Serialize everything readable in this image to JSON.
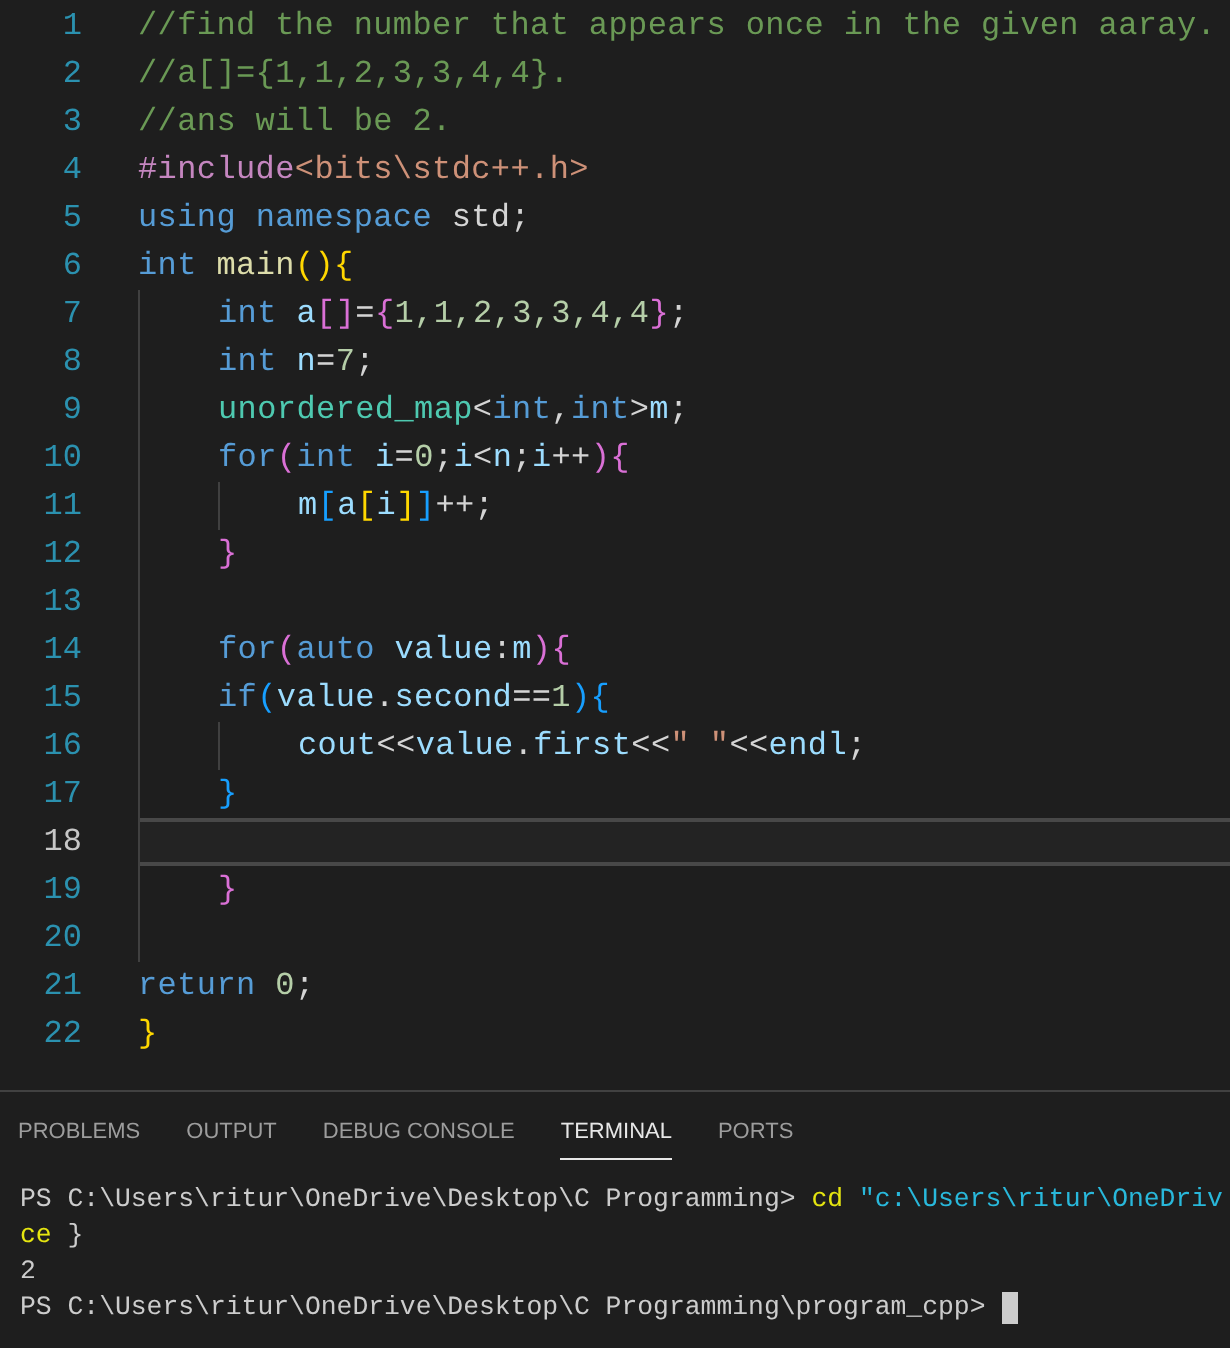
{
  "editor": {
    "lines": [
      {
        "number": "1",
        "current": false,
        "tokens": [
          {
            "text": "//find the number that appears once in the given aaray.",
            "kind": "comment"
          }
        ]
      },
      {
        "number": "2",
        "current": false,
        "tokens": [
          {
            "text": "//a[]={1,1,2,3,3,4,4}.",
            "kind": "comment"
          }
        ]
      },
      {
        "number": "3",
        "current": false,
        "tokens": [
          {
            "text": "//ans will be 2.",
            "kind": "comment"
          }
        ]
      },
      {
        "number": "4",
        "current": false,
        "tokens": [
          {
            "text": "#include",
            "kind": "directive"
          },
          {
            "text": "<bits\\stdc++.h>",
            "kind": "string"
          }
        ]
      },
      {
        "number": "5",
        "current": false,
        "tokens": [
          {
            "text": "using ",
            "kind": "keyword"
          },
          {
            "text": "namespace ",
            "kind": "keyword"
          },
          {
            "text": "std;",
            "kind": "plain"
          }
        ]
      },
      {
        "number": "6",
        "current": false,
        "tokens": [
          {
            "text": "int ",
            "kind": "keyword"
          },
          {
            "text": "main",
            "kind": "function"
          },
          {
            "text": "(){",
            "kind": "bracket1"
          }
        ]
      },
      {
        "number": "7",
        "current": false,
        "tokens": [
          {
            "kind": "indent"
          },
          {
            "text": "int ",
            "kind": "keyword"
          },
          {
            "text": "a",
            "kind": "variable"
          },
          {
            "text": "[]",
            "kind": "bracket2"
          },
          {
            "text": "=",
            "kind": "plain"
          },
          {
            "text": "{",
            "kind": "bracket2"
          },
          {
            "text": "1,1,2,3,3,4,4",
            "kind": "number"
          },
          {
            "text": "}",
            "kind": "bracket2"
          },
          {
            "text": ";",
            "kind": "plain"
          }
        ]
      },
      {
        "number": "8",
        "current": false,
        "tokens": [
          {
            "kind": "indent"
          },
          {
            "text": "int ",
            "kind": "keyword"
          },
          {
            "text": "n",
            "kind": "variable"
          },
          {
            "text": "=",
            "kind": "plain"
          },
          {
            "text": "7",
            "kind": "number"
          },
          {
            "text": ";",
            "kind": "plain"
          }
        ]
      },
      {
        "number": "9",
        "current": false,
        "tokens": [
          {
            "kind": "indent"
          },
          {
            "text": "unordered_map",
            "kind": "type"
          },
          {
            "text": "<",
            "kind": "plain"
          },
          {
            "text": "int",
            "kind": "keyword"
          },
          {
            "text": ",",
            "kind": "plain"
          },
          {
            "text": "int",
            "kind": "keyword"
          },
          {
            "text": ">",
            "kind": "plain"
          },
          {
            "text": "m",
            "kind": "variable"
          },
          {
            "text": ";",
            "kind": "plain"
          }
        ]
      },
      {
        "number": "10",
        "current": false,
        "tokens": [
          {
            "kind": "indent"
          },
          {
            "text": "for",
            "kind": "keyword"
          },
          {
            "text": "(",
            "kind": "bracket2"
          },
          {
            "text": "int ",
            "kind": "keyword"
          },
          {
            "text": "i",
            "kind": "variable"
          },
          {
            "text": "=",
            "kind": "plain"
          },
          {
            "text": "0",
            "kind": "number"
          },
          {
            "text": ";",
            "kind": "plain"
          },
          {
            "text": "i",
            "kind": "variable"
          },
          {
            "text": "<",
            "kind": "plain"
          },
          {
            "text": "n",
            "kind": "variable"
          },
          {
            "text": ";",
            "kind": "plain"
          },
          {
            "text": "i",
            "kind": "variable"
          },
          {
            "text": "++",
            "kind": "plain"
          },
          {
            "text": ")",
            "kind": "bracket2"
          },
          {
            "text": "{",
            "kind": "bracket2"
          }
        ]
      },
      {
        "number": "11",
        "current": false,
        "tokens": [
          {
            "kind": "indent"
          },
          {
            "kind": "indent"
          },
          {
            "text": "m",
            "kind": "variable"
          },
          {
            "text": "[",
            "kind": "bracket3"
          },
          {
            "text": "a",
            "kind": "variable"
          },
          {
            "text": "[",
            "kind": "bracket1"
          },
          {
            "text": "i",
            "kind": "variable"
          },
          {
            "text": "]",
            "kind": "bracket1"
          },
          {
            "text": "]",
            "kind": "bracket3"
          },
          {
            "text": "++;",
            "kind": "plain"
          }
        ]
      },
      {
        "number": "12",
        "current": false,
        "tokens": [
          {
            "kind": "indent"
          },
          {
            "text": "}",
            "kind": "bracket2"
          }
        ]
      },
      {
        "number": "13",
        "current": false,
        "tokens": [
          {
            "kind": "indent"
          }
        ]
      },
      {
        "number": "14",
        "current": false,
        "tokens": [
          {
            "kind": "indent"
          },
          {
            "text": "for",
            "kind": "keyword"
          },
          {
            "text": "(",
            "kind": "bracket2"
          },
          {
            "text": "auto ",
            "kind": "keyword"
          },
          {
            "text": "value",
            "kind": "variable"
          },
          {
            "text": ":",
            "kind": "plain"
          },
          {
            "text": "m",
            "kind": "variable"
          },
          {
            "text": ")",
            "kind": "bracket2"
          },
          {
            "text": "{",
            "kind": "bracket2"
          }
        ]
      },
      {
        "number": "15",
        "current": false,
        "tokens": [
          {
            "kind": "indent"
          },
          {
            "text": "if",
            "kind": "keyword"
          },
          {
            "text": "(",
            "kind": "bracket3"
          },
          {
            "text": "value",
            "kind": "variable"
          },
          {
            "text": ".",
            "kind": "plain"
          },
          {
            "text": "second",
            "kind": "variable"
          },
          {
            "text": "==",
            "kind": "plain"
          },
          {
            "text": "1",
            "kind": "number"
          },
          {
            "text": ")",
            "kind": "bracket3"
          },
          {
            "text": "{",
            "kind": "bracket3"
          }
        ]
      },
      {
        "number": "16",
        "current": false,
        "tokens": [
          {
            "kind": "indent"
          },
          {
            "kind": "indent"
          },
          {
            "text": "cout",
            "kind": "variable"
          },
          {
            "text": "<<",
            "kind": "plain"
          },
          {
            "text": "value",
            "kind": "variable"
          },
          {
            "text": ".",
            "kind": "plain"
          },
          {
            "text": "first",
            "kind": "variable"
          },
          {
            "text": "<<",
            "kind": "plain"
          },
          {
            "text": "\" \"",
            "kind": "string"
          },
          {
            "text": "<<",
            "kind": "plain"
          },
          {
            "text": "endl",
            "kind": "variable"
          },
          {
            "text": ";",
            "kind": "plain"
          }
        ]
      },
      {
        "number": "17",
        "current": false,
        "tokens": [
          {
            "kind": "indent"
          },
          {
            "text": "}",
            "kind": "bracket3"
          }
        ]
      },
      {
        "number": "18",
        "current": true,
        "tokens": [
          {
            "kind": "indent"
          }
        ]
      },
      {
        "number": "19",
        "current": false,
        "tokens": [
          {
            "kind": "indent"
          },
          {
            "text": "}",
            "kind": "bracket2"
          }
        ]
      },
      {
        "number": "20",
        "current": false,
        "tokens": [
          {
            "kind": "indent"
          }
        ]
      },
      {
        "number": "21",
        "current": false,
        "tokens": [
          {
            "text": "return ",
            "kind": "keyword"
          },
          {
            "text": "0",
            "kind": "number"
          },
          {
            "text": ";",
            "kind": "plain"
          }
        ]
      },
      {
        "number": "22",
        "current": false,
        "tokens": [
          {
            "text": "}",
            "kind": "bracket1"
          }
        ]
      }
    ]
  },
  "panel": {
    "tabs": [
      {
        "label": "PROBLEMS",
        "selected": false
      },
      {
        "label": "OUTPUT",
        "selected": false
      },
      {
        "label": "DEBUG CONSOLE",
        "selected": false
      },
      {
        "label": "TERMINAL",
        "selected": true
      },
      {
        "label": "PORTS",
        "selected": false
      }
    ],
    "terminal": {
      "lines": [
        {
          "segments": [
            {
              "text": "PS C:\\Users\\ritur\\OneDrive\\Desktop\\C Programming> ",
              "kind": "plain"
            },
            {
              "text": "cd",
              "kind": "command"
            },
            {
              "text": " \"c:\\Users\\ritur\\OneDriv",
              "kind": "argument"
            }
          ]
        },
        {
          "segments": [
            {
              "text": "ce",
              "kind": "command"
            },
            {
              "text": " }",
              "kind": "plain"
            }
          ]
        },
        {
          "segments": [
            {
              "text": "2",
              "kind": "plain"
            }
          ]
        },
        {
          "segments": [
            {
              "text": "PS C:\\Users\\ritur\\OneDrive\\Desktop\\C Programming\\program_cpp> ",
              "kind": "plain"
            }
          ],
          "cursor": true
        }
      ]
    }
  }
}
